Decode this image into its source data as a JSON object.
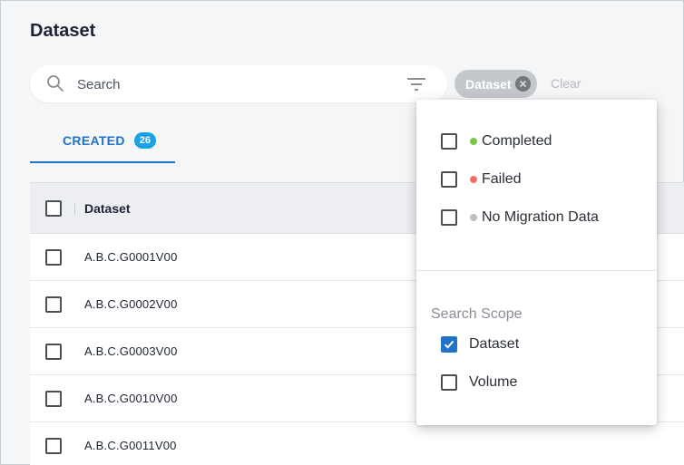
{
  "page": {
    "title": "Dataset"
  },
  "search": {
    "placeholder": "Search"
  },
  "chips": [
    {
      "label": "Dataset"
    }
  ],
  "clear_label": "Clear",
  "tabs": [
    {
      "label": "CREATED",
      "count": "26"
    }
  ],
  "table": {
    "columns": [
      "Dataset"
    ],
    "rows": [
      "A.B.C.G0001V00",
      "A.B.C.G0002V00",
      "A.B.C.G0003V00",
      "A.B.C.G0010V00",
      "A.B.C.G0011V00"
    ]
  },
  "filter_menu": {
    "status_options": [
      {
        "label": "Completed",
        "checked": false,
        "color": "#7bc843"
      },
      {
        "label": "Failed",
        "checked": false,
        "color": "#f0706a"
      },
      {
        "label": "No Migration Data",
        "checked": false,
        "color": "#bdbfc3"
      }
    ],
    "scope_title": "Search Scope",
    "scope_options": [
      {
        "label": "Dataset",
        "checked": true
      },
      {
        "label": "Volume",
        "checked": false
      }
    ]
  },
  "colors": {
    "accent": "#1f73c8",
    "badge": "#1aa2e8",
    "chip": "#c4c7cc"
  }
}
